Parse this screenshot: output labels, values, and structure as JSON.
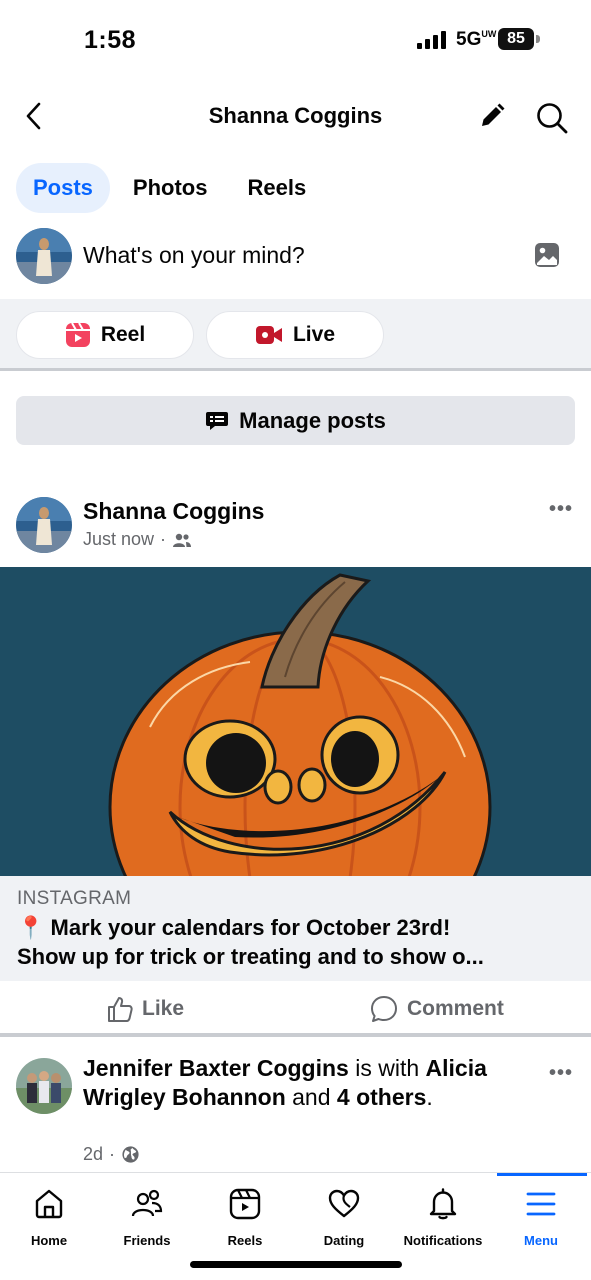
{
  "status_bar": {
    "time": "1:58",
    "network": "5G",
    "network_sub": "UW",
    "battery": "85"
  },
  "header": {
    "title": "Shanna Coggins"
  },
  "tabs": [
    {
      "label": "Posts",
      "active": true
    },
    {
      "label": "Photos",
      "active": false
    },
    {
      "label": "Reels",
      "active": false
    }
  ],
  "composer": {
    "placeholder": "What's on your mind?"
  },
  "actions": {
    "reel": "Reel",
    "live": "Live",
    "manage": "Manage posts"
  },
  "post1": {
    "author": "Shanna Coggins",
    "time": "Just now",
    "link_source": "INSTAGRAM",
    "link_title": "📍 Mark your calendars for October 23rd!",
    "link_title_2": "Show up for trick or treating and to show o...",
    "like": "Like",
    "comment": "Comment"
  },
  "post2": {
    "author": "Jennifer Baxter Coggins",
    "with_text": " is with ",
    "tagged": "Alicia Wrigley Bohannon",
    "and_text": " and ",
    "others": "4 others",
    "period": ".",
    "time": "2d"
  },
  "bottom_nav": [
    {
      "label": "Home",
      "icon": "home-icon"
    },
    {
      "label": "Friends",
      "icon": "friends-icon"
    },
    {
      "label": "Reels",
      "icon": "reels-icon"
    },
    {
      "label": "Dating",
      "icon": "dating-icon"
    },
    {
      "label": "Notifications",
      "icon": "bell-icon"
    },
    {
      "label": "Menu",
      "icon": "menu-icon",
      "active": true
    }
  ],
  "colors": {
    "accent": "#0866ff",
    "secondary_text": "#65676b",
    "surface": "#f0f2f5",
    "image_bg": "#1e4d63"
  }
}
